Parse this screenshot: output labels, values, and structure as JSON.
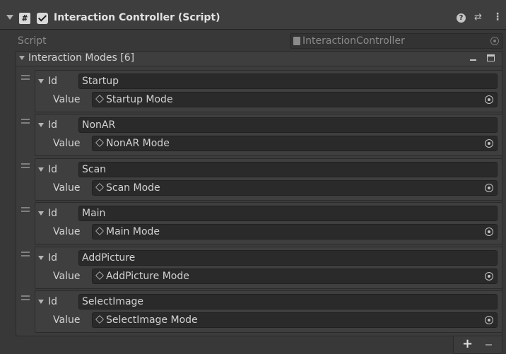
{
  "component": {
    "title": "Interaction Controller (Script)",
    "enabled": true,
    "script_label": "Script",
    "script_value": "InteractionController"
  },
  "list": {
    "title": "Interaction Modes [6]",
    "id_label": "Id",
    "value_label": "Value",
    "items": [
      {
        "id": "Startup",
        "value": "Startup Mode"
      },
      {
        "id": "NonAR",
        "value": "NonAR Mode"
      },
      {
        "id": "Scan",
        "value": "Scan Mode"
      },
      {
        "id": "Main",
        "value": "Main Mode"
      },
      {
        "id": "AddPicture",
        "value": "AddPicture Mode"
      },
      {
        "id": "SelectImage",
        "value": "SelectImage Mode"
      }
    ]
  },
  "icons": {
    "script": "script-icon",
    "help": "help-icon",
    "preset": "preset-icon",
    "menu": "kebab-menu-icon",
    "object": "cube-icon",
    "picker": "object-picker-icon"
  },
  "colors": {
    "background": "#383838",
    "field": "#2a2a2a",
    "text": "#d2d2d2",
    "muted_text": "#8a8a8a"
  }
}
